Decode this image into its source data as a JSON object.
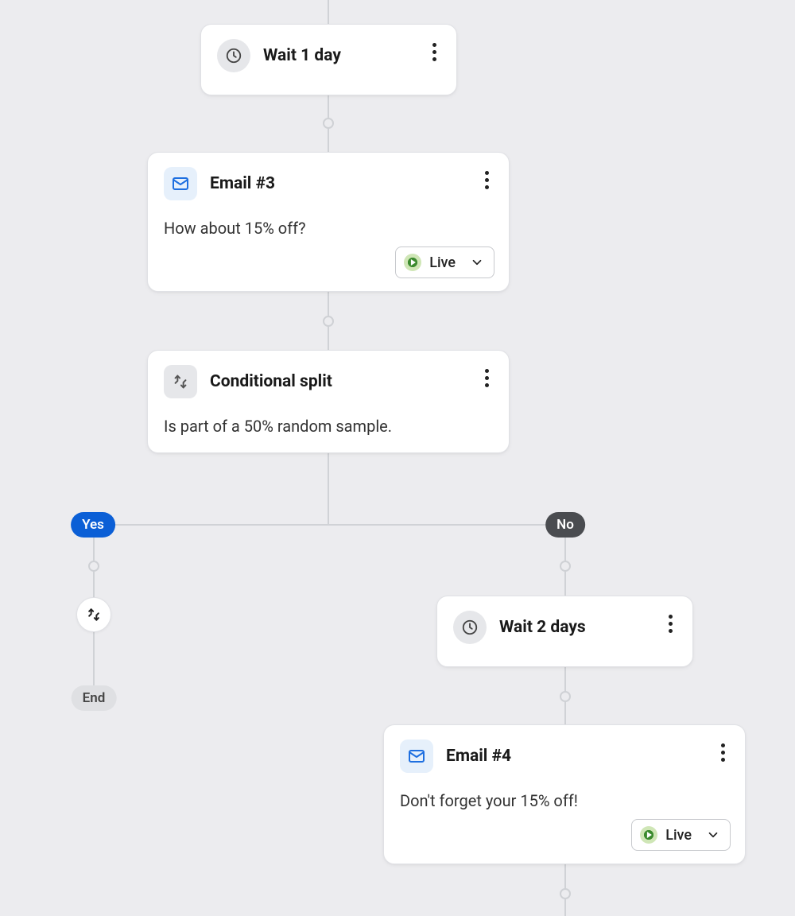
{
  "flow": {
    "nodes": {
      "wait1": {
        "title": "Wait 1 day"
      },
      "email3": {
        "title": "Email #3",
        "desc": "How about 15% off?",
        "status": "Live"
      },
      "split": {
        "title": "Conditional split",
        "desc": "Is part of a 50% random sample."
      },
      "wait2": {
        "title": "Wait 2 days"
      },
      "email4": {
        "title": "Email #4",
        "desc": "Don't forget your 15% off!",
        "status": "Live"
      }
    },
    "branches": {
      "yes": "Yes",
      "no": "No",
      "end": "End"
    }
  }
}
